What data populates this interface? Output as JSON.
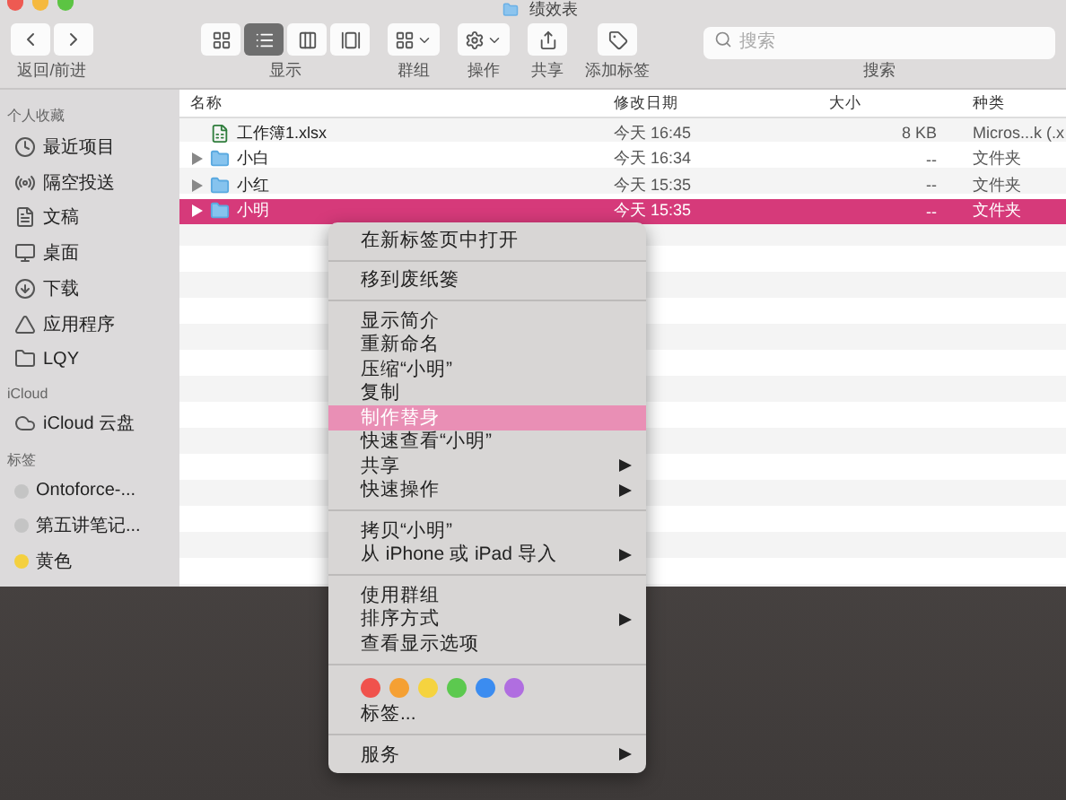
{
  "window": {
    "title": "绩效表"
  },
  "toolbar": {
    "nav_label": "返回/前进",
    "views": [
      {
        "kind": "icons",
        "selected": false
      },
      {
        "kind": "list",
        "selected": true
      },
      {
        "kind": "columns",
        "selected": false
      },
      {
        "kind": "gallery",
        "selected": false
      }
    ],
    "groups": [
      {
        "kind": "view",
        "label": "显示"
      },
      {
        "kind": "group",
        "label": "群组"
      },
      {
        "kind": "action",
        "label": "操作"
      },
      {
        "kind": "share",
        "label": "共享"
      },
      {
        "kind": "tag",
        "label": "添加标签"
      }
    ],
    "search": {
      "placeholder": "搜索",
      "label": "搜索"
    }
  },
  "sidebar": {
    "sections": [
      {
        "heading": "个人收藏",
        "items": [
          {
            "kind": "recents",
            "label": "最近项目"
          },
          {
            "kind": "airdrop",
            "label": "隔空投送"
          },
          {
            "kind": "documents",
            "label": "文稿"
          },
          {
            "kind": "desktop",
            "label": "桌面"
          },
          {
            "kind": "downloads",
            "label": "下载"
          },
          {
            "kind": "applications",
            "label": "应用程序"
          },
          {
            "kind": "folder",
            "label": "LQY"
          }
        ]
      },
      {
        "heading": "iCloud",
        "items": [
          {
            "kind": "cloud",
            "label": "iCloud 云盘"
          }
        ]
      },
      {
        "heading": "标签",
        "items": [
          {
            "kind": "tag",
            "label": "Ontoforce-...",
            "color": "#c4c4c4"
          },
          {
            "kind": "tag",
            "label": "第五讲笔记...",
            "color": "#c4c4c4"
          },
          {
            "kind": "tag",
            "label": "黄色",
            "color": "#f4d03f"
          }
        ]
      }
    ]
  },
  "table": {
    "columns": [
      "名称",
      "修改日期",
      "大小",
      "种类"
    ],
    "rows": [
      {
        "kind": "file",
        "name": "工作簿1.xlsx",
        "date": "今天 16:45",
        "size": "8 KB",
        "kind_label": "Micros...k (.x",
        "selected": false
      },
      {
        "kind": "folder",
        "name": "小白",
        "date": "今天 16:34",
        "size": "--",
        "kind_label": "文件夹",
        "selected": false
      },
      {
        "kind": "folder",
        "name": "小红",
        "date": "今天 15:35",
        "size": "--",
        "kind_label": "文件夹",
        "selected": false
      },
      {
        "kind": "folder",
        "name": "小明",
        "date": "今天 15:35",
        "size": "--",
        "kind_label": "文件夹",
        "selected": true
      }
    ]
  },
  "context_menu": {
    "sections": [
      [
        {
          "label": "在新标签页中打开",
          "submenu": false,
          "selected": false
        }
      ],
      [
        {
          "label": "移到废纸篓",
          "submenu": false,
          "selected": false
        }
      ],
      [
        {
          "label": "显示简介",
          "submenu": false,
          "selected": false
        },
        {
          "label": "重新命名",
          "submenu": false,
          "selected": false
        },
        {
          "label": "压缩“小明”",
          "submenu": false,
          "selected": false
        },
        {
          "label": "复制",
          "submenu": false,
          "selected": false
        },
        {
          "label": "制作替身",
          "submenu": false,
          "selected": true
        },
        {
          "label": "快速查看“小明”",
          "submenu": false,
          "selected": false
        },
        {
          "label": "共享",
          "submenu": true,
          "selected": false
        },
        {
          "label": "快速操作",
          "submenu": true,
          "selected": false
        }
      ],
      [
        {
          "label": "拷贝“小明”",
          "submenu": false,
          "selected": false
        },
        {
          "label": "从 iPhone 或 iPad 导入",
          "submenu": true,
          "selected": false
        }
      ],
      [
        {
          "label": "使用群组",
          "submenu": false,
          "selected": false
        },
        {
          "label": "排序方式",
          "submenu": true,
          "selected": false
        },
        {
          "label": "查看显示选项",
          "submenu": false,
          "selected": false
        }
      ]
    ],
    "tag_colors": [
      {
        "color": "#f0524c"
      },
      {
        "color": "#f5a033"
      },
      {
        "color": "#f5d33f"
      },
      {
        "color": "#5cc94f"
      },
      {
        "color": "#3b8cf0"
      },
      {
        "color": "#b06ee0"
      }
    ],
    "tags_label": "标签...",
    "services": {
      "label": "服务",
      "submenu": true
    }
  }
}
